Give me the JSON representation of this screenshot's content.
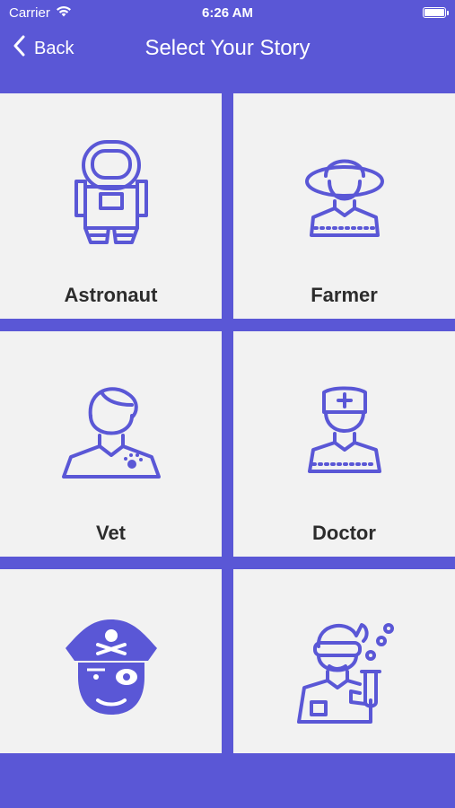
{
  "status_bar": {
    "carrier": "Carrier",
    "time": "6:26 AM"
  },
  "nav": {
    "back_label": "Back",
    "title": "Select Your Story"
  },
  "stories": [
    {
      "label": "Astronaut",
      "icon": "astronaut-icon"
    },
    {
      "label": "Farmer",
      "icon": "farmer-icon"
    },
    {
      "label": "Vet",
      "icon": "vet-icon"
    },
    {
      "label": "Doctor",
      "icon": "doctor-icon"
    },
    {
      "label": "",
      "icon": "pirate-icon"
    },
    {
      "label": "",
      "icon": "scientist-icon"
    }
  ],
  "colors": {
    "accent": "#5a57d6",
    "tile_bg": "#f2f2f2",
    "label": "#2c2c2c"
  }
}
